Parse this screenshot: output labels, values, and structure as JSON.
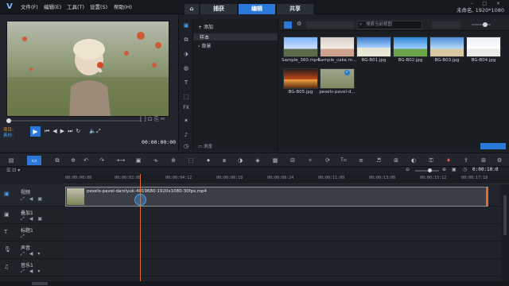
{
  "app": {
    "logo": "V",
    "title": "未命名, 1920*1080"
  },
  "menu": [
    "文件(F)",
    "编辑(E)",
    "工具(T)",
    "设置(S)",
    "帮助(H)"
  ],
  "tabs": {
    "home": "⌂",
    "capture": "捕获",
    "edit": "编辑",
    "share": "共享"
  },
  "player": {
    "project_label": "项目-",
    "clip_label": "素材-",
    "timecode": "00:00:00:00"
  },
  "folders": {
    "add": "添加",
    "sample": "样本",
    "background": "背景",
    "browse": "浏览"
  },
  "library": {
    "search_placeholder": "搜索当前视图",
    "items": [
      {
        "label": "Sample_360.mp4",
        "kind": "video"
      },
      {
        "label": "Sample_cake.m...",
        "kind": "video"
      },
      {
        "label": "BG-B01.jpg",
        "kind": "image"
      },
      {
        "label": "BG-B02.jpg",
        "kind": "image"
      },
      {
        "label": "BG-B03.jpg",
        "kind": "image"
      },
      {
        "label": "BG-B04.jpg",
        "kind": "image"
      },
      {
        "label": "BG-B05.jpg",
        "kind": "image"
      },
      {
        "label": "pexels-pavel-d...",
        "kind": "video"
      }
    ]
  },
  "ruler": [
    "00:00:00:00",
    "00:00:02:08",
    "00:00:04:12",
    "00:00:06:18",
    "00:00:08:24",
    "00:00:11:00",
    "00:00:13:06",
    "00:00:15:12",
    "00:00:17:18"
  ],
  "timeline_readout": "0:00:10:0",
  "tracks": [
    {
      "name": "视频",
      "type": "video"
    },
    {
      "name": "叠加1",
      "type": "overlay"
    },
    {
      "name": "标题1",
      "type": "title"
    },
    {
      "name": "声音",
      "type": "voice"
    },
    {
      "name": "音乐1",
      "type": "music"
    }
  ],
  "clip": {
    "label": "pexels-pavel-danilyuk-4019680-1920x1080-30fps.mp4"
  },
  "colors": {
    "accent": "#2a78d8",
    "playhead": "#e06b2d"
  }
}
